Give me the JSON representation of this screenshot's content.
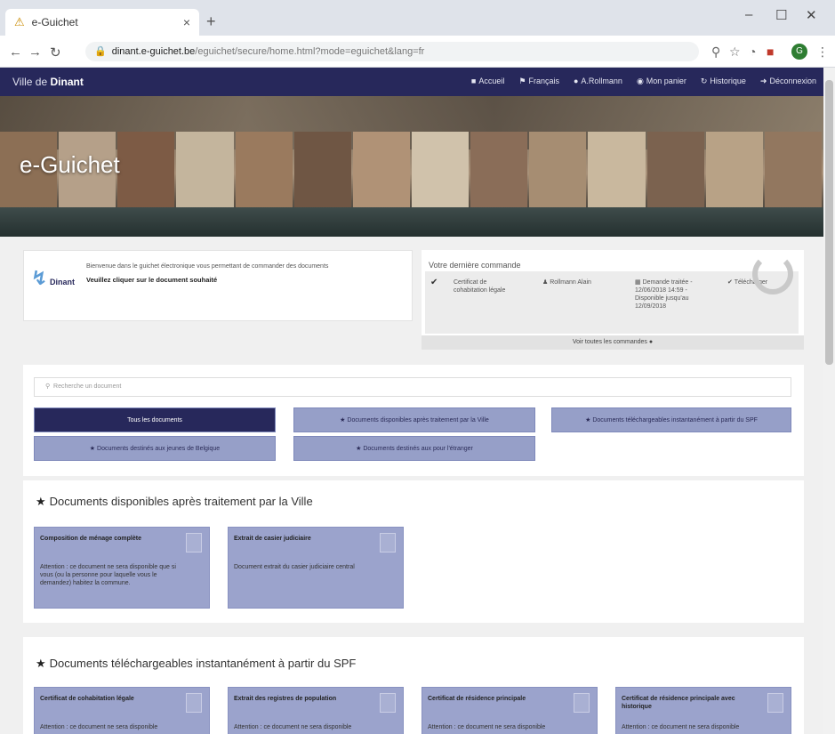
{
  "browser": {
    "tab_title": "e-Guichet",
    "tab_close": "×",
    "new_tab": "+",
    "url_host": "dinant.e-guichet.be",
    "url_path": "/eguichet/secure/home.html?mode=eguichet&lang=fr",
    "win_min": "–",
    "win_max": "☐",
    "win_close": "✕",
    "profile_initial": "G"
  },
  "sitenav": {
    "brand_prefix": "Ville de",
    "brand_name": "Dinant",
    "links": [
      "Accueil",
      "Français",
      "A.Rollmann",
      "Mon panier",
      "Historique",
      "Déconnexion"
    ]
  },
  "hero": {
    "title": "e-Guichet"
  },
  "welcome": {
    "logo_text": "Dinant",
    "text": "Bienvenue dans le guichet électronique vous permettant de commander des documents",
    "bold_text": "Veuillez cliquer sur le document souhaité"
  },
  "last_order": {
    "title": "Votre dernière commande",
    "document": "Certificat de cohabitation légale",
    "person": "Rollmann Alain",
    "status": "Demande traitée - 12/06/2018 14:59 - Disponible jusqu'au 12/09/2018",
    "action": "Télécharger",
    "footer": "Voir toutes les commandes"
  },
  "panel": {
    "search_placeholder": "Recherche un document",
    "filters": [
      "Tous les documents",
      "Documents disponibles après traitement par la Ville",
      "Documents téléchargeables instantanément à partir du SPF",
      "Documents destinés aux jeunes de Belgique",
      "Documents destinés aux pour l'étranger"
    ]
  },
  "section1": {
    "title": "Documents disponibles après traitement par la Ville",
    "docs": [
      {
        "title": "Composition de ménage complète",
        "desc": "Attention : ce document ne sera disponible que si vous (ou la personne pour laquelle vous le demandez) habitez la commune."
      },
      {
        "title": "Extrait de casier judiciaire",
        "desc": "Document extrait du casier judiciaire central"
      }
    ]
  },
  "section2": {
    "title": "Documents téléchargeables instantanément à partir du SPF",
    "docs": [
      {
        "title": "Certificat de cohabitation légale",
        "desc": "Attention : ce document ne sera disponible"
      },
      {
        "title": "Extrait des registres de population",
        "desc": "Attention : ce document ne sera disponible"
      },
      {
        "title": "Certificat de résidence principale",
        "desc": "Attention : ce document ne sera disponible"
      },
      {
        "title": "Certificat de résidence principale avec historique",
        "desc": "Attention : ce document ne sera disponible"
      }
    ]
  }
}
